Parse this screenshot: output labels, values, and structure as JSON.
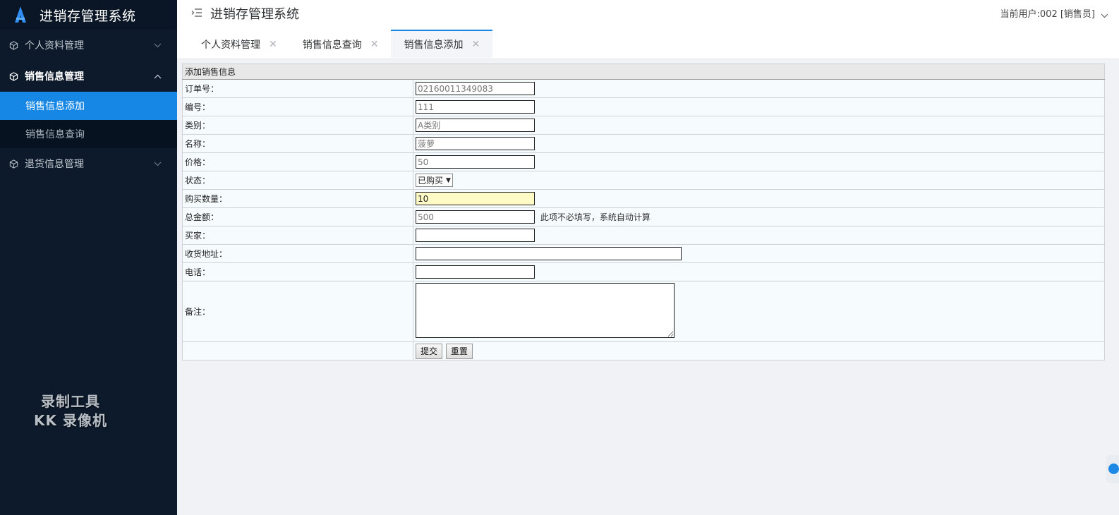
{
  "app": {
    "title": "进销存管理系统"
  },
  "sidebar": {
    "groups": [
      {
        "label": "个人资料管理",
        "open": false
      },
      {
        "label": "销售信息管理",
        "open": true,
        "items": [
          {
            "label": "销售信息添加",
            "active": true
          },
          {
            "label": "销售信息查询",
            "active": false
          }
        ]
      },
      {
        "label": "退货信息管理",
        "open": false
      }
    ]
  },
  "watermark": {
    "line1": "录制工具",
    "line2": "KK 录像机"
  },
  "header": {
    "title": "进销存管理系统",
    "user": "当前用户:002 [销售员]"
  },
  "tabs": [
    {
      "label": "个人资料管理",
      "close": "✕"
    },
    {
      "label": "销售信息查询",
      "close": "✕"
    },
    {
      "label": "销售信息添加",
      "close": "✕"
    }
  ],
  "form": {
    "caption": "添加销售信息",
    "fields": {
      "order_no": {
        "label": "订单号：",
        "value": "02160011349083"
      },
      "code": {
        "label": "编号：",
        "value": "111"
      },
      "category": {
        "label": "类别：",
        "value": "A类别"
      },
      "name": {
        "label": "名称：",
        "value": "菠萝"
      },
      "price": {
        "label": "价格：",
        "value": "50"
      },
      "status": {
        "label": "状态：",
        "value": "已购买"
      },
      "quantity": {
        "label": "购买数量：",
        "value": "10"
      },
      "total": {
        "label": "总金额：",
        "value": "500",
        "hint": "此项不必填写，系统自动计算"
      },
      "buyer": {
        "label": "买家：",
        "value": ""
      },
      "address": {
        "label": "收货地址：",
        "value": ""
      },
      "phone": {
        "label": "电话：",
        "value": ""
      },
      "remark": {
        "label": "备注：",
        "value": ""
      }
    },
    "buttons": {
      "submit": "提交",
      "reset": "重置"
    }
  },
  "colors": {
    "sidebar_bg": "#0c1a2b",
    "accent": "#1787e6"
  }
}
